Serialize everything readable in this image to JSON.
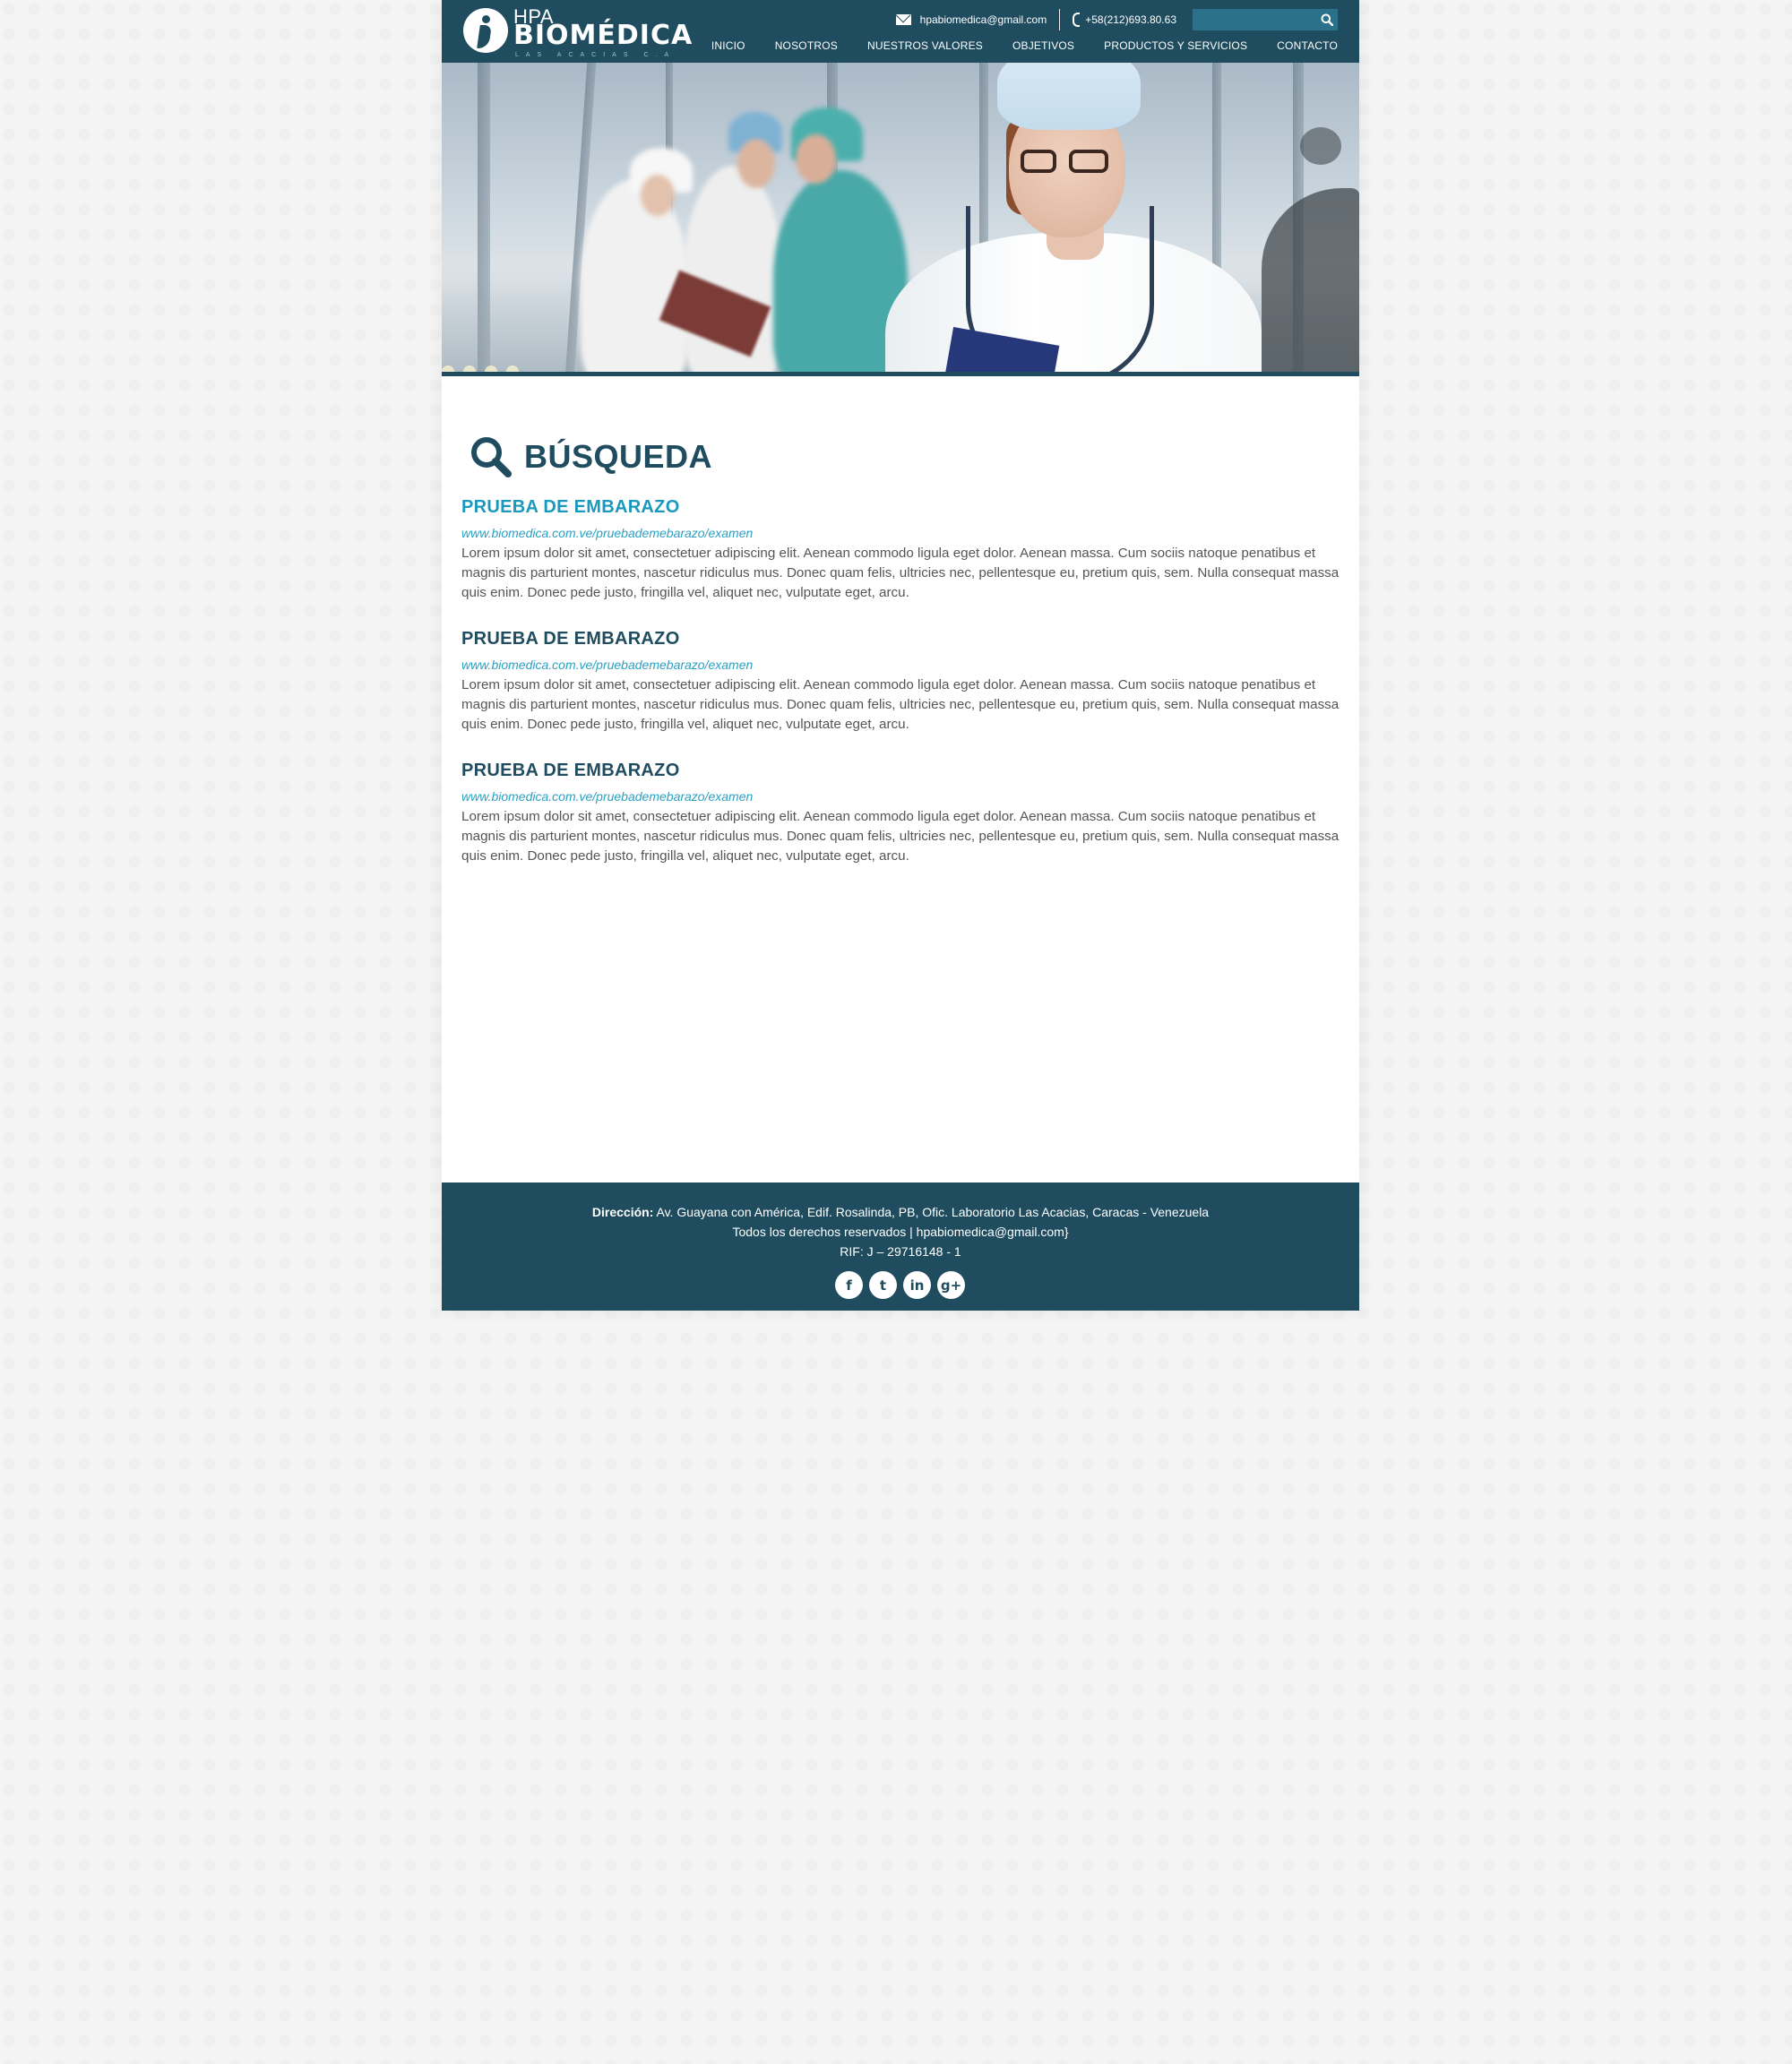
{
  "header": {
    "logo": {
      "prefix": "HPA",
      "name": "BIOMÉDICA",
      "tagline": "LAS ACACIAS C.A"
    },
    "email": "hpabiomedica@gmail.com",
    "phone": "+58(212)693.80.63",
    "search_value": "",
    "nav": [
      "INICIO",
      "NOSOTROS",
      "NUESTROS VALORES",
      "OBJETIVOS",
      "PRODUCTOS Y SERVICIOS",
      "CONTACTO"
    ]
  },
  "hero": {
    "slide_count": 4
  },
  "main": {
    "title": "BÚSQUEDA",
    "results": [
      {
        "title": "PRUEBA DE EMBARAZO",
        "title_color": "#1a99bf",
        "url": "www.biomedica.com.ve/pruebademebarazo/examen",
        "description": "Lorem ipsum dolor sit amet, consectetuer adipiscing elit. Aenean commodo ligula eget dolor. Aenean massa. Cum sociis natoque penatibus et magnis dis parturient montes, nascetur ridiculus mus. Donec quam felis, ultricies nec, pellentesque eu, pretium quis, sem. Nulla consequat massa quis enim. Donec pede justo, fringilla vel, aliquet nec, vulputate eget, arcu."
      },
      {
        "title": "PRUEBA DE EMBARAZO",
        "title_color": "#1f4d5f",
        "url": "www.biomedica.com.ve/pruebademebarazo/examen",
        "description": "Lorem ipsum dolor sit amet, consectetuer adipiscing elit. Aenean commodo ligula eget dolor. Aenean massa. Cum sociis natoque penatibus et magnis dis parturient montes, nascetur ridiculus mus. Donec quam felis, ultricies nec, pellentesque eu, pretium quis, sem. Nulla consequat massa quis enim. Donec pede justo, fringilla vel, aliquet nec, vulputate eget, arcu."
      },
      {
        "title": "PRUEBA DE EMBARAZO",
        "title_color": "#1f4d5f",
        "url": "www.biomedica.com.ve/pruebademebarazo/examen",
        "description": "Lorem ipsum dolor sit amet, consectetuer adipiscing elit. Aenean commodo ligula eget dolor. Aenean massa. Cum sociis natoque penatibus et magnis dis parturient montes, nascetur ridiculus mus. Donec quam felis, ultricies nec, pellentesque eu, pretium quis, sem. Nulla consequat massa quis enim. Donec pede justo, fringilla vel, aliquet nec, vulputate eget, arcu."
      }
    ]
  },
  "footer": {
    "address_label": "Dirección:",
    "address": "Av. Guayana con América, Edif. Rosalinda, PB, Ofic. Laboratorio Las Acacias, Caracas - Venezuela",
    "rights": "Todos los derechos reservados | hpabiomedica@gmail.com}",
    "rif": "RIF: J – 29716148 - 1",
    "socials": [
      {
        "name": "facebook-icon",
        "glyph": "f"
      },
      {
        "name": "twitter-icon",
        "glyph": "t"
      },
      {
        "name": "linkedin-icon",
        "glyph": "in"
      },
      {
        "name": "google-plus-icon",
        "glyph": "g+"
      }
    ]
  },
  "colors": {
    "brand": "#1f4d5f",
    "accent": "#2ba0c2",
    "search_field": "#2a7189"
  }
}
